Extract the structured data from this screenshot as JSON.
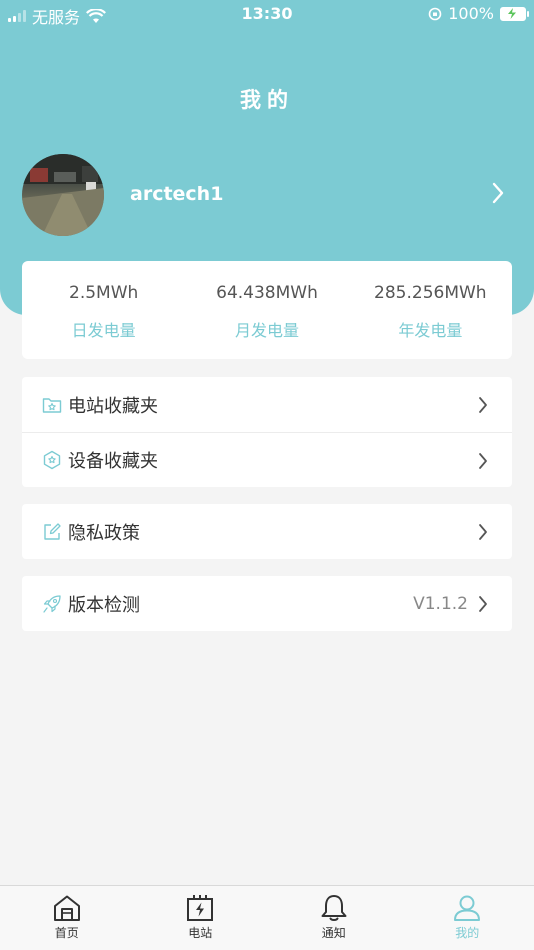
{
  "status_bar": {
    "carrier": "无服务",
    "time": "13:30",
    "battery": "100%"
  },
  "header": {
    "title": "我的",
    "username": "arctech1"
  },
  "stats": [
    {
      "value": "2.5MWh",
      "label": "日发电量"
    },
    {
      "value": "64.438MWh",
      "label": "月发电量"
    },
    {
      "value": "285.256MWh",
      "label": "年发电量"
    }
  ],
  "menu": {
    "station_favorites": "电站收藏夹",
    "device_favorites": "设备收藏夹",
    "privacy_policy": "隐私政策",
    "version_check": "版本检测",
    "version_value": "V1.1.2"
  },
  "tabs": [
    {
      "label": "首页",
      "icon": "home-icon"
    },
    {
      "label": "电站",
      "icon": "power-station-icon"
    },
    {
      "label": "通知",
      "icon": "bell-icon"
    },
    {
      "label": "我的",
      "icon": "user-icon"
    }
  ],
  "colors": {
    "accent": "#7ccbd3",
    "background": "#f4f4f4"
  }
}
